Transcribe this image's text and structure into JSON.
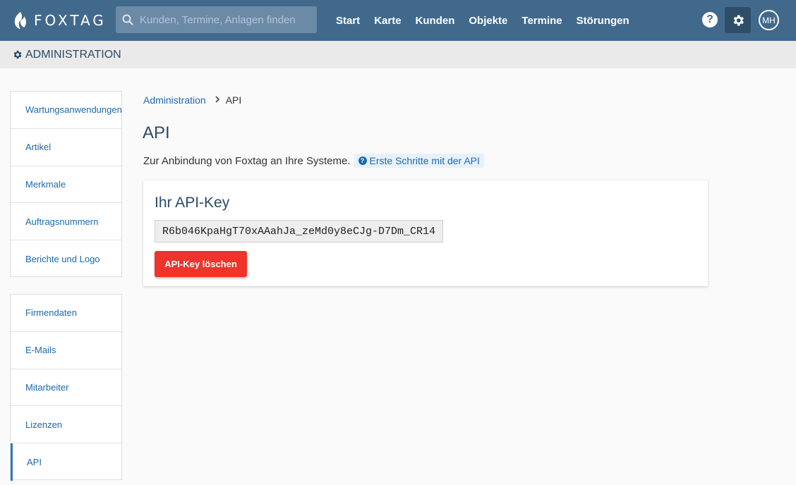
{
  "app": {
    "logo_text": "FOXTAG"
  },
  "search": {
    "placeholder": "Kunden, Termine, Anlagen finden"
  },
  "nav": {
    "items": [
      "Start",
      "Karte",
      "Kunden",
      "Objekte",
      "Termine",
      "Störungen"
    ]
  },
  "user": {
    "initials": "MH"
  },
  "header": {
    "help_label": "?",
    "section_title": "ADMINISTRATION"
  },
  "sidebar": {
    "group1": [
      "Wartungsanwendungen",
      "Artikel",
      "Merkmale",
      "Auftragsnummern",
      "Berichte und Logo"
    ],
    "group2": [
      "Firmendaten",
      "E-Mails",
      "Mitarbeiter",
      "Lizenzen",
      "API"
    ],
    "active": "API"
  },
  "breadcrumb": {
    "parent": "Administration",
    "current": "API"
  },
  "page": {
    "title": "API",
    "intro": "Zur Anbindung von Foxtag an Ihre Systeme.",
    "help_link": "Erste Schritte mit der API"
  },
  "card": {
    "title": "Ihr API-Key",
    "api_key": "R6b046KpaHgT70xAAahJa_zeMd0y8eCJg-D7Dm_CR14",
    "delete_button": "API-Key löschen"
  },
  "colors": {
    "navbar": "#41698c",
    "accent": "#1b6ab0",
    "danger": "#f0332b"
  },
  "icons": [
    "fox-logo-icon",
    "search-icon",
    "help-icon",
    "gear-icon",
    "question-circle-icon",
    "chevron-right-icon"
  ]
}
